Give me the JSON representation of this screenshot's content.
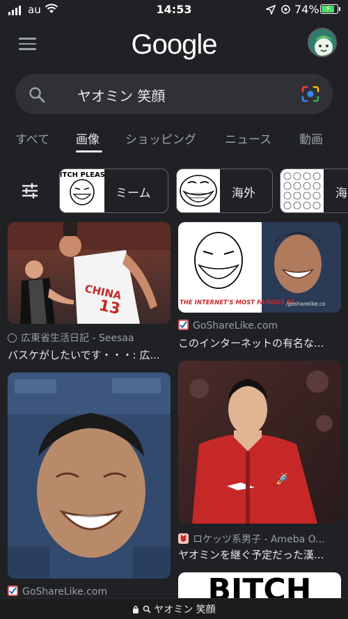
{
  "status": {
    "carrier": "au",
    "time": "14:53",
    "battery_text": "74%",
    "battery_level": 0.74,
    "battery_color": "#4cd964"
  },
  "header": {
    "logo": "Google",
    "menu_icon": "hamburger-icon",
    "avatar_icon": "profile-avatar"
  },
  "search": {
    "query": "ヤオミン 笑顔",
    "left_icon": "search-icon",
    "right_icon": "google-lens-icon"
  },
  "tabs": [
    {
      "label": "すべて",
      "active": false
    },
    {
      "label": "画像",
      "active": true
    },
    {
      "label": "ショッピング",
      "active": false
    },
    {
      "label": "ニュース",
      "active": false
    },
    {
      "label": "動画",
      "active": false
    }
  ],
  "chips": [
    {
      "label": "ミーム",
      "thumb_text": "BITCH PLEASE"
    },
    {
      "label": "海外"
    },
    {
      "label": "海"
    }
  ],
  "results": [
    {
      "source": "広東省生活日記 - Seesaa",
      "title": "バスケがしたいです・・・: 広...",
      "jersey": "CHINA",
      "number": "13"
    },
    {
      "source": "GoShareLike.com",
      "title": "このインターネットの有名な...",
      "caption": "THE INTERNET'S MOST FAMOUS FA",
      "watermark": "/gosharelike.co"
    },
    {
      "source": "GoShareLike.com",
      "title": ""
    },
    {
      "source": "ロケッツ系男子 - Ameba O...",
      "title": "ヤオミンを継ぐ予定だった漢..."
    },
    {
      "source": "",
      "title": "",
      "banner": "BITCH"
    }
  ],
  "urlbar": {
    "text": "ヤオミン 笑顔",
    "icons": [
      "lock-icon",
      "search-icon"
    ]
  },
  "colors": {
    "background": "#202124",
    "surface": "#303134",
    "text_primary": "#e8eaed",
    "text_secondary": "#9aa0a6"
  }
}
